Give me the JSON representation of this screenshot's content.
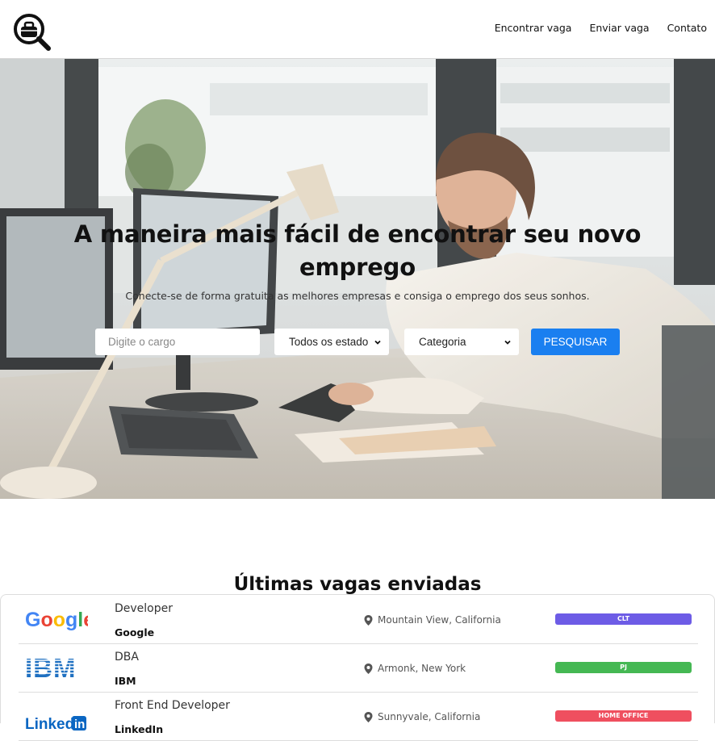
{
  "nav": {
    "items": [
      "Encontrar vaga",
      "Enviar vaga",
      "Contato"
    ]
  },
  "hero": {
    "title": "A maneira mais fácil de encontrar seu novo emprego",
    "subtitle": "Conecte-se de forma gratuita as melhores empresas e consiga o emprego dos seus sonhos."
  },
  "search": {
    "placeholder": "Digite o cargo",
    "state_select": "Todos os estado",
    "category_select": "Categoria",
    "button": "PESQUISAR"
  },
  "section": {
    "title": "Últimas vagas enviadas"
  },
  "jobs": [
    {
      "title": "Developer",
      "company": "Google",
      "location": "Mountain View, California",
      "type": "CLT",
      "color": "#6d5ce6",
      "logo": "google-logo"
    },
    {
      "title": "DBA",
      "company": "IBM",
      "location": "Armonk, New York",
      "type": "PJ",
      "color": "#45b853",
      "logo": "ibm-logo"
    },
    {
      "title": "Front End Developer",
      "company": "LinkedIn",
      "location": "Sunnyvale, California",
      "type": "HOME OFFICE",
      "color": "#ef4f5f",
      "logo": "linkedin-logo"
    }
  ],
  "colors": {
    "primary": "#1a7ff0"
  }
}
